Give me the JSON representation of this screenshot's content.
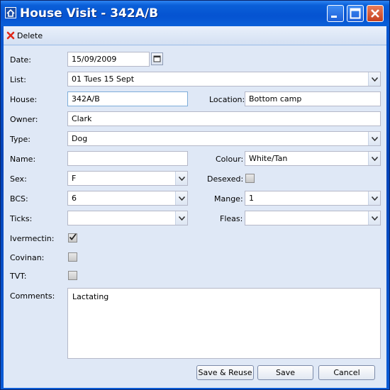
{
  "window": {
    "title": "House Visit - 342A/B",
    "icon": "app-icon"
  },
  "toolbar": {
    "delete_label": "Delete",
    "delete_icon": "delete-x-icon"
  },
  "labels": {
    "date": "Date:",
    "list": "List:",
    "house": "House:",
    "location": "Location:",
    "owner": "Owner:",
    "type": "Type:",
    "name": "Name:",
    "colour": "Colour:",
    "sex": "Sex:",
    "desexed": "Desexed:",
    "bcs": "BCS:",
    "mange": "Mange:",
    "ticks": "Ticks:",
    "fleas": "Fleas:",
    "ivermectin": "Ivermectin:",
    "covinan": "Covinan:",
    "tvt": "TVT:",
    "comments": "Comments:"
  },
  "values": {
    "date": "15/09/2009",
    "list": "01 Tues 15 Sept",
    "house": "342A/B",
    "location": "Bottom camp",
    "owner": "Clark",
    "type": "Dog",
    "name": "",
    "colour": "White/Tan",
    "sex": "F",
    "desexed": false,
    "bcs": "6",
    "mange": "1",
    "ticks": "",
    "fleas": "",
    "ivermectin": true,
    "covinan": false,
    "tvt": false,
    "comments": "Lactating"
  },
  "buttons": {
    "save_reuse": "Save & Reuse",
    "save": "Save",
    "cancel": "Cancel"
  },
  "colors": {
    "title_bar": "#0553d1",
    "form_bg": "#dfe8f6",
    "field_border": "#b5b8c8",
    "delete_icon": "#e0281a"
  }
}
